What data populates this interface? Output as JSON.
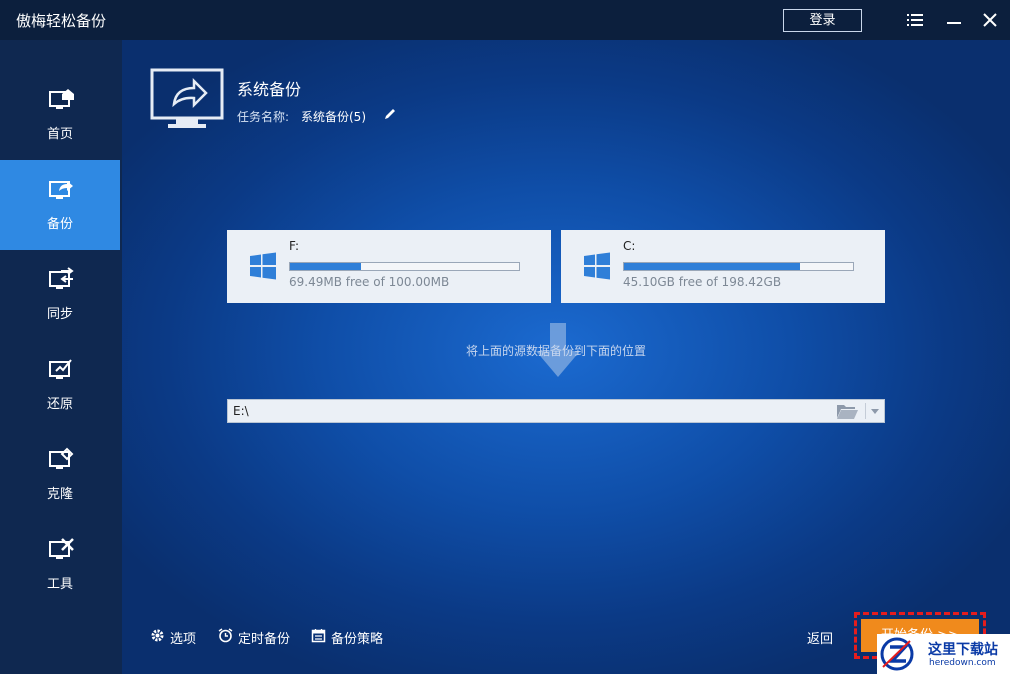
{
  "window": {
    "title": "傲梅轻松备份",
    "login_label": "登录"
  },
  "sidebar": {
    "items": [
      {
        "label": "首页",
        "icon": "home-monitor-icon",
        "active": false
      },
      {
        "label": "备份",
        "icon": "backup-monitor-icon",
        "active": true
      },
      {
        "label": "同步",
        "icon": "sync-monitor-icon",
        "active": false
      },
      {
        "label": "还原",
        "icon": "restore-monitor-icon",
        "active": false
      },
      {
        "label": "克隆",
        "icon": "clone-monitor-icon",
        "active": false
      },
      {
        "label": "工具",
        "icon": "tools-monitor-icon",
        "active": false
      }
    ]
  },
  "header": {
    "title": "系统备份",
    "task_label": "任务名称:",
    "task_name": "系统备份(5)"
  },
  "sources": [
    {
      "name": "F:",
      "free_text": "69.49MB free of 100.00MB",
      "used_fraction": 0.31
    },
    {
      "name": "C:",
      "free_text": "45.10GB free of 198.42GB",
      "used_fraction": 0.77
    }
  ],
  "hint": "将上面的源数据备份到下面的位置",
  "destination": {
    "path": "E:\\"
  },
  "footer": {
    "options_label": "选项",
    "schedule_label": "定时备份",
    "scheme_label": "备份策略",
    "back_label": "返回",
    "start_label": "开始备份 >>"
  },
  "watermark": {
    "title": "这里下载站",
    "url": "heredown.com"
  },
  "colors": {
    "sidebar_active": "#2f89e3",
    "start_button": "#f08a1c",
    "progress_fill": "#2f7fd8",
    "highlight_border": "#e51d1d"
  }
}
